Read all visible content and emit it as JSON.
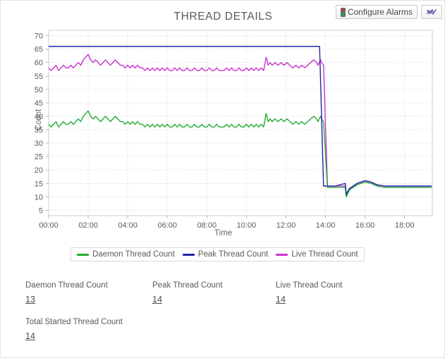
{
  "header": {
    "title": "THREAD DETAILS",
    "configure_alarms_label": "Configure Alarms",
    "configure_alarms_icon": "traffic-light-icon",
    "chart_options_icon": "chart-icon"
  },
  "colors": {
    "daemon": "#22aa33",
    "peak": "#2222aa",
    "live": "#cc33cc",
    "grid": "#d5d5dd",
    "axis": "#b8b8b8",
    "text": "#5a5a5a"
  },
  "stats": [
    {
      "label": "Daemon Thread Count",
      "value": "13"
    },
    {
      "label": "Peak Thread Count",
      "value": "14"
    },
    {
      "label": "Live Thread Count",
      "value": "14"
    },
    {
      "label": "Total Started Thread Count",
      "value": "14"
    }
  ],
  "chart_data": {
    "type": "line",
    "title": "THREAD DETAILS",
    "xlabel": "Time",
    "ylabel": "Count",
    "grid": true,
    "legend_position": "bottom",
    "xlim": [
      0,
      19.4
    ],
    "ylim": [
      3,
      72
    ],
    "yticks": [
      5,
      10,
      15,
      20,
      25,
      30,
      35,
      40,
      45,
      50,
      55,
      60,
      65,
      70
    ],
    "xticks": [
      0,
      2,
      4,
      6,
      8,
      10,
      12,
      14,
      16,
      18
    ],
    "xticklabels": [
      "00:00",
      "02:00",
      "04:00",
      "06:00",
      "08:00",
      "10:00",
      "12:00",
      "14:00",
      "16:00",
      "18:00"
    ],
    "series": [
      {
        "name": "Daemon Thread Count",
        "color": "#22aa33",
        "x": [
          0.0,
          0.12,
          0.25,
          0.37,
          0.5,
          0.62,
          0.75,
          0.87,
          1.0,
          1.12,
          1.25,
          1.37,
          1.5,
          1.62,
          1.75,
          1.87,
          2.0,
          2.12,
          2.25,
          2.37,
          2.5,
          2.62,
          2.75,
          2.87,
          3.0,
          3.12,
          3.25,
          3.37,
          3.5,
          3.62,
          3.75,
          3.87,
          4.0,
          4.12,
          4.25,
          4.37,
          4.5,
          4.62,
          4.75,
          4.87,
          5.0,
          5.12,
          5.25,
          5.37,
          5.5,
          5.62,
          5.75,
          5.87,
          6.0,
          6.12,
          6.25,
          6.37,
          6.5,
          6.62,
          6.75,
          6.87,
          7.0,
          7.12,
          7.25,
          7.37,
          7.5,
          7.62,
          7.75,
          7.87,
          8.0,
          8.12,
          8.25,
          8.37,
          8.5,
          8.62,
          8.75,
          8.87,
          9.0,
          9.12,
          9.25,
          9.37,
          9.5,
          9.62,
          9.75,
          9.87,
          10.0,
          10.12,
          10.25,
          10.37,
          10.5,
          10.62,
          10.75,
          10.87,
          11.0,
          11.1,
          11.2,
          11.3,
          11.45,
          11.6,
          11.75,
          11.9,
          12.05,
          12.2,
          12.35,
          12.5,
          12.65,
          12.8,
          12.95,
          13.1,
          13.25,
          13.4,
          13.55,
          13.62,
          13.68,
          13.75,
          13.8,
          13.9,
          14.1,
          14.5,
          15.0,
          15.05,
          15.2,
          15.6,
          16.0,
          16.3,
          16.6,
          17.0,
          17.4,
          17.8,
          18.2,
          18.6,
          19.0,
          19.35
        ],
        "y": [
          37,
          36,
          37,
          38,
          36,
          37,
          38,
          37,
          37,
          38,
          37,
          38,
          39,
          38,
          40,
          41,
          42,
          40,
          39,
          40,
          39,
          38,
          39,
          40,
          39,
          38,
          39,
          40,
          39,
          38,
          38,
          37,
          38,
          37,
          38,
          37,
          38,
          37,
          37,
          36,
          37,
          36,
          37,
          36,
          37,
          36,
          37,
          36,
          37,
          36,
          36,
          37,
          36,
          37,
          36,
          36,
          37,
          36,
          36,
          37,
          36,
          36,
          37,
          36,
          36,
          37,
          36,
          36,
          37,
          36,
          36,
          36,
          37,
          36,
          37,
          36,
          36,
          37,
          36,
          36,
          37,
          36,
          37,
          36,
          37,
          36,
          37,
          36,
          41,
          38,
          39,
          38,
          39,
          38,
          39,
          38,
          39,
          38,
          37,
          38,
          37,
          38,
          37,
          38,
          39,
          40,
          39,
          38,
          39,
          40,
          39,
          38,
          13.5,
          13.5,
          13.5,
          10,
          12.5,
          14.5,
          15.5,
          15,
          14,
          13.5,
          13.5,
          13.5,
          13.5,
          13.5,
          13.5,
          13.5
        ]
      },
      {
        "name": "Peak Thread Count",
        "color": "#2222aa",
        "x": [
          0,
          13.7,
          13.8,
          13.9,
          14.1,
          14.5,
          15.0,
          15.05,
          15.2,
          15.6,
          16.0,
          16.3,
          16.6,
          17.0,
          17.4,
          17.8,
          18.2,
          18.6,
          19.0,
          19.35
        ],
        "y": [
          66,
          66,
          40,
          14,
          14,
          14,
          15,
          11,
          13,
          15,
          16,
          15.5,
          14.5,
          14,
          14,
          14,
          14,
          14,
          14,
          14
        ]
      },
      {
        "name": "Live Thread Count",
        "color": "#cc33cc",
        "x": [
          0.0,
          0.12,
          0.25,
          0.37,
          0.5,
          0.62,
          0.75,
          0.87,
          1.0,
          1.12,
          1.25,
          1.37,
          1.5,
          1.62,
          1.75,
          1.87,
          2.0,
          2.12,
          2.25,
          2.37,
          2.5,
          2.62,
          2.75,
          2.87,
          3.0,
          3.12,
          3.25,
          3.37,
          3.5,
          3.62,
          3.75,
          3.87,
          4.0,
          4.12,
          4.25,
          4.37,
          4.5,
          4.62,
          4.75,
          4.87,
          5.0,
          5.12,
          5.25,
          5.37,
          5.5,
          5.62,
          5.75,
          5.87,
          6.0,
          6.12,
          6.25,
          6.37,
          6.5,
          6.62,
          6.75,
          6.87,
          7.0,
          7.12,
          7.25,
          7.37,
          7.5,
          7.62,
          7.75,
          7.87,
          8.0,
          8.12,
          8.25,
          8.37,
          8.5,
          8.62,
          8.75,
          8.87,
          9.0,
          9.12,
          9.25,
          9.37,
          9.5,
          9.62,
          9.75,
          9.87,
          10.0,
          10.12,
          10.25,
          10.37,
          10.5,
          10.62,
          10.75,
          10.87,
          11.0,
          11.1,
          11.2,
          11.3,
          11.45,
          11.6,
          11.75,
          11.9,
          12.05,
          12.2,
          12.35,
          12.5,
          12.65,
          12.8,
          12.95,
          13.1,
          13.25,
          13.4,
          13.55,
          13.62,
          13.68,
          13.75,
          13.8,
          13.9,
          14.1,
          14.5,
          15.0,
          15.05,
          15.2,
          15.6,
          16.0,
          16.3,
          16.6,
          17.0,
          17.4,
          17.8,
          18.2,
          18.6,
          19.0,
          19.35
        ],
        "y": [
          58,
          57,
          58,
          59,
          57,
          58,
          59,
          58,
          58,
          59,
          58,
          59,
          60,
          59,
          61,
          62,
          63,
          61,
          60,
          61,
          60,
          59,
          60,
          61,
          60,
          59,
          60,
          61,
          60,
          59,
          59,
          58,
          59,
          58,
          59,
          58,
          59,
          58,
          58,
          57,
          58,
          57,
          58,
          57,
          58,
          57,
          58,
          57,
          58,
          57,
          57,
          58,
          57,
          58,
          57,
          57,
          58,
          57,
          57,
          58,
          57,
          57,
          58,
          57,
          57,
          58,
          57,
          57,
          58,
          57,
          57,
          57,
          58,
          57,
          58,
          57,
          57,
          58,
          57,
          57,
          58,
          57,
          58,
          57,
          58,
          57,
          58,
          57,
          62,
          59,
          60,
          59,
          60,
          59,
          60,
          59,
          60,
          59,
          58,
          59,
          58,
          59,
          58,
          59,
          60,
          61,
          60,
          59,
          60,
          61,
          60,
          59,
          14,
          14,
          14,
          10.5,
          13,
          15,
          16,
          15.5,
          14.5,
          14,
          14,
          14,
          14,
          14,
          14,
          14
        ]
      }
    ]
  }
}
